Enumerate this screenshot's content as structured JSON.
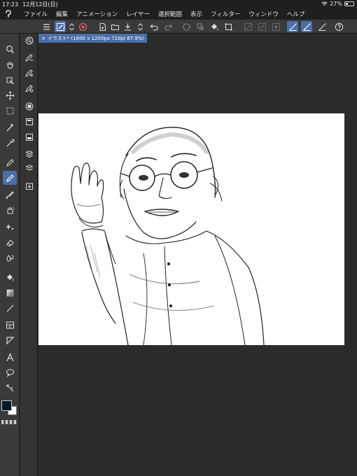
{
  "status": {
    "time": "17:23",
    "date": "12月12日(日)",
    "battery": "27%",
    "battery_level": 0.27
  },
  "menu": {
    "items": [
      "ファイル",
      "編集",
      "アニメーション",
      "レイヤー",
      "選択範囲",
      "表示",
      "フィルター",
      "ウィンドウ",
      "ヘルプ"
    ]
  },
  "toolbar": {
    "icons": [
      "menu-icon",
      "draw-mode-icon",
      "chevron-updown-icon",
      "gallery-icon",
      "new-file-icon",
      "open-folder-icon",
      "save-icon",
      "chevron-updown-icon",
      "undo-icon",
      "redo-icon",
      "clear-selection-icon",
      "copy-icon",
      "fill-icon",
      "transform-icon",
      "snap-1-icon",
      "snap-2-icon",
      "snap-3-icon",
      "ruler-1-icon",
      "ruler-2-icon",
      "ruler-3-icon",
      "help-icon"
    ]
  },
  "tools": {
    "icons": [
      "zoom-icon",
      "hand-icon",
      "move-layer-icon",
      "operation-icon",
      "selection-icon",
      "auto-select-icon",
      "eyedropper-icon",
      "pen-icon",
      "pencil-icon",
      "brush-icon",
      "airbrush-icon",
      "decoration-icon",
      "eraser-icon",
      "blend-icon",
      "fill-icon",
      "gradient-icon",
      "figure-icon",
      "frame-icon",
      "ruler-icon",
      "text-icon",
      "balloon-icon",
      "correct-line-icon"
    ],
    "active_index": 8
  },
  "subtools": {
    "icons": [
      "zoom-subtool-icon",
      "pencil-subtool-icon",
      "pencil-subtool-2-icon",
      "pencil-subtool-3-icon",
      "layer-property-icon",
      "layer-icon",
      "layer-2-icon",
      "material-icon",
      "navigator-icon",
      "layers-icon",
      "import-icon"
    ]
  },
  "canvas_tab": {
    "title": "イラスト* (1600 x 1200px 72dpi 87.9%)"
  },
  "colors": {
    "main": "#0a1428",
    "sub": "#ffffff",
    "accent": "#4b6ea8"
  }
}
